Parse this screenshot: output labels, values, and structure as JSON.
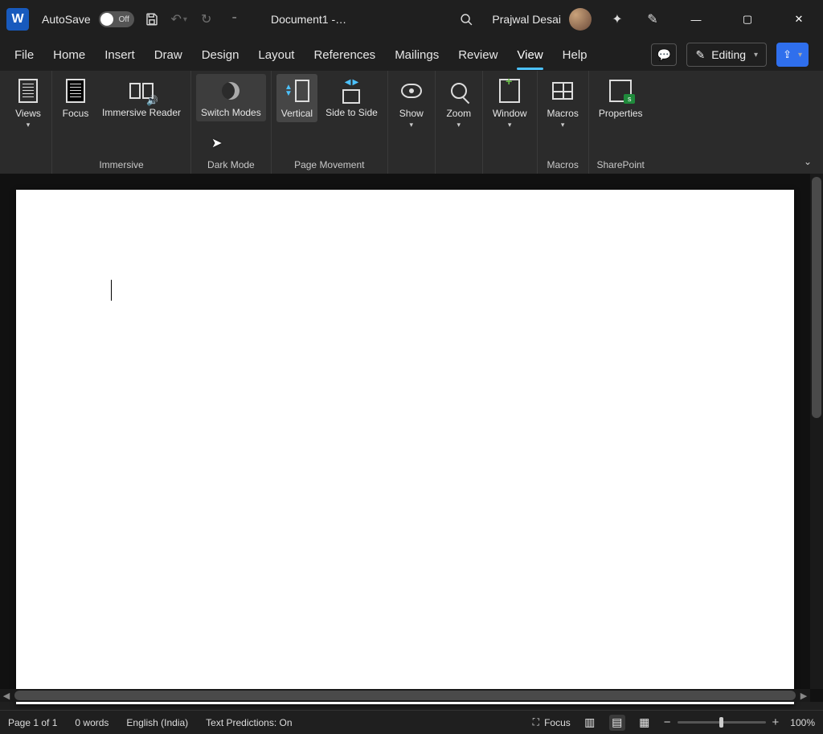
{
  "titlebar": {
    "autosave_label": "AutoSave",
    "autosave_state": "Off",
    "document_name": "Document1  -…",
    "user_name": "Prajwal Desai"
  },
  "tabs": [
    "File",
    "Home",
    "Insert",
    "Draw",
    "Design",
    "Layout",
    "References",
    "Mailings",
    "Review",
    "View",
    "Help"
  ],
  "active_tab": "View",
  "editing_button": "Editing",
  "ribbon": {
    "views": "Views",
    "focus": "Focus",
    "reader": "Immersive Reader",
    "switch": "Switch Modes",
    "vertical": "Vertical",
    "side": "Side to Side",
    "show": "Show",
    "zoom": "Zoom",
    "window": "Window",
    "macros": "Macros",
    "properties": "Properties",
    "group_immersive": "Immersive",
    "group_darkmode": "Dark Mode",
    "group_pagemove": "Page Movement",
    "group_macros": "Macros",
    "group_sharepoint": "SharePoint"
  },
  "statusbar": {
    "page": "Page 1 of 1",
    "words": "0 words",
    "language": "English (India)",
    "predictions": "Text Predictions: On",
    "focus_label": "Focus",
    "zoom_pct": "100%"
  }
}
